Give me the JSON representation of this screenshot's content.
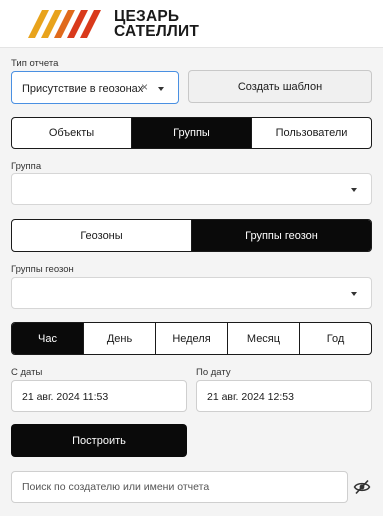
{
  "brand": {
    "line1": "ЦЕЗАРЬ",
    "line2": "САТЕЛЛИТ",
    "accent": "#e8a31c",
    "accent_red": "#d93a1c"
  },
  "report_type": {
    "label": "Тип отчета",
    "value": "Присутствие в геозонах",
    "clear": "×"
  },
  "create_template_label": "Создать шаблон",
  "entity_tabs": [
    "Объекты",
    "Группы",
    "Пользователи"
  ],
  "entity_active": "Группы",
  "group": {
    "label": "Группа",
    "value": ""
  },
  "geo_tabs": [
    "Геозоны",
    "Группы геозон"
  ],
  "geo_active": "Группы геозон",
  "geo_group": {
    "label": "Группы геозон",
    "value": ""
  },
  "period_tabs": [
    "Час",
    "День",
    "Неделя",
    "Месяц",
    "Год"
  ],
  "period_active": "Час",
  "date_from": {
    "label": "С даты",
    "value": "21 авг. 2024 11:53"
  },
  "date_to": {
    "label": "По дату",
    "value": "21 авг. 2024 12:53"
  },
  "build_label": "Построить",
  "search": {
    "placeholder": "Поиск по создателю или имени отчета",
    "value": ""
  },
  "icons": {
    "caret": "chevron-down-icon",
    "visibility": "eye-off-icon"
  }
}
